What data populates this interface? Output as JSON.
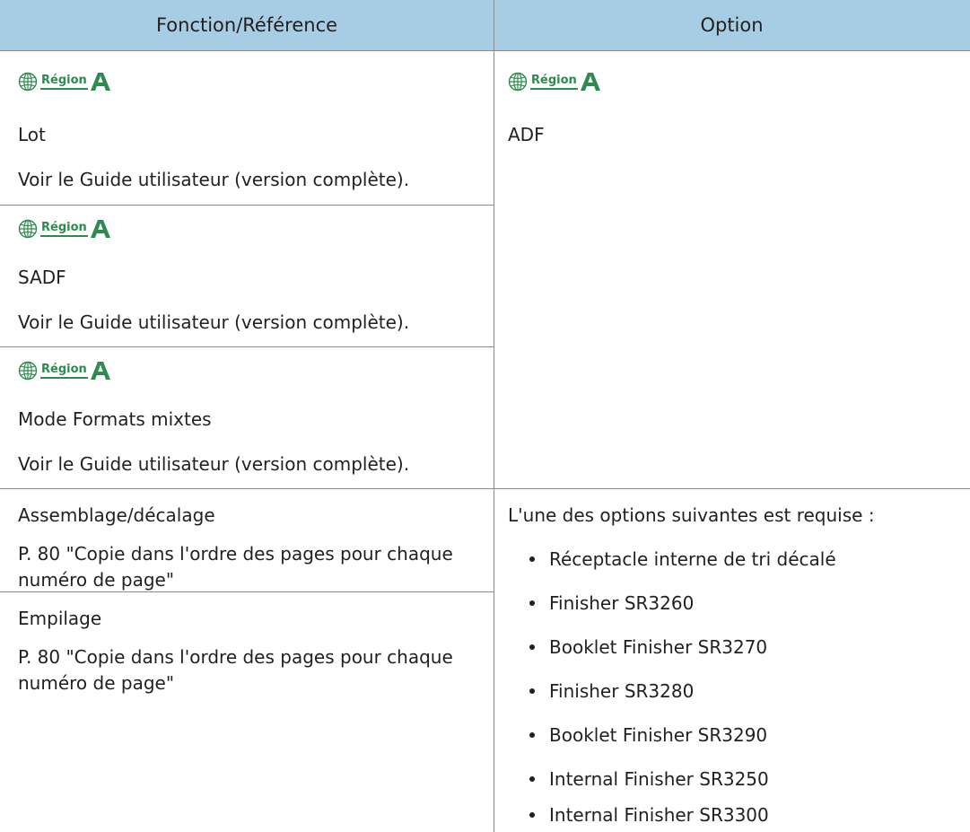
{
  "table": {
    "headers": [
      "Fonction/Référence",
      "Option"
    ],
    "region_label": "Région",
    "region_letter": "A",
    "left_rows": [
      {
        "title": "Lot",
        "reference": "Voir le Guide utilisateur (version complète)."
      },
      {
        "title": "SADF",
        "reference": "Voir le Guide utilisateur (version complète)."
      },
      {
        "title": "Mode Formats mixtes",
        "reference": "Voir le Guide utilisateur (version complète)."
      },
      {
        "title": "Assemblage/décalage",
        "reference_line1": "P. 80 \"Copie dans l'ordre des pages pour chaque",
        "reference_line2": "numéro de page\""
      },
      {
        "title": "Empilage",
        "reference_line1": "P. 80 \"Copie dans l'ordre des pages pour chaque",
        "reference_line2": "numéro de page\""
      }
    ],
    "right_rows": [
      {
        "option": "ADF"
      },
      {
        "intro": "L'une des options suivantes est requise :",
        "items": [
          "Réceptacle interne de tri décalé",
          "Finisher SR3260",
          "Booklet Finisher SR3270",
          "Finisher SR3280",
          "Booklet Finisher SR3290",
          "Internal Finisher SR3250",
          "Internal Finisher SR3300"
        ]
      }
    ]
  },
  "colors": {
    "header_bg": "#a6cde3",
    "region_green": "#2f8a4f",
    "rule": "#8c8c8c",
    "text": "#231f20"
  },
  "icons": {
    "region": "globe-icon"
  }
}
